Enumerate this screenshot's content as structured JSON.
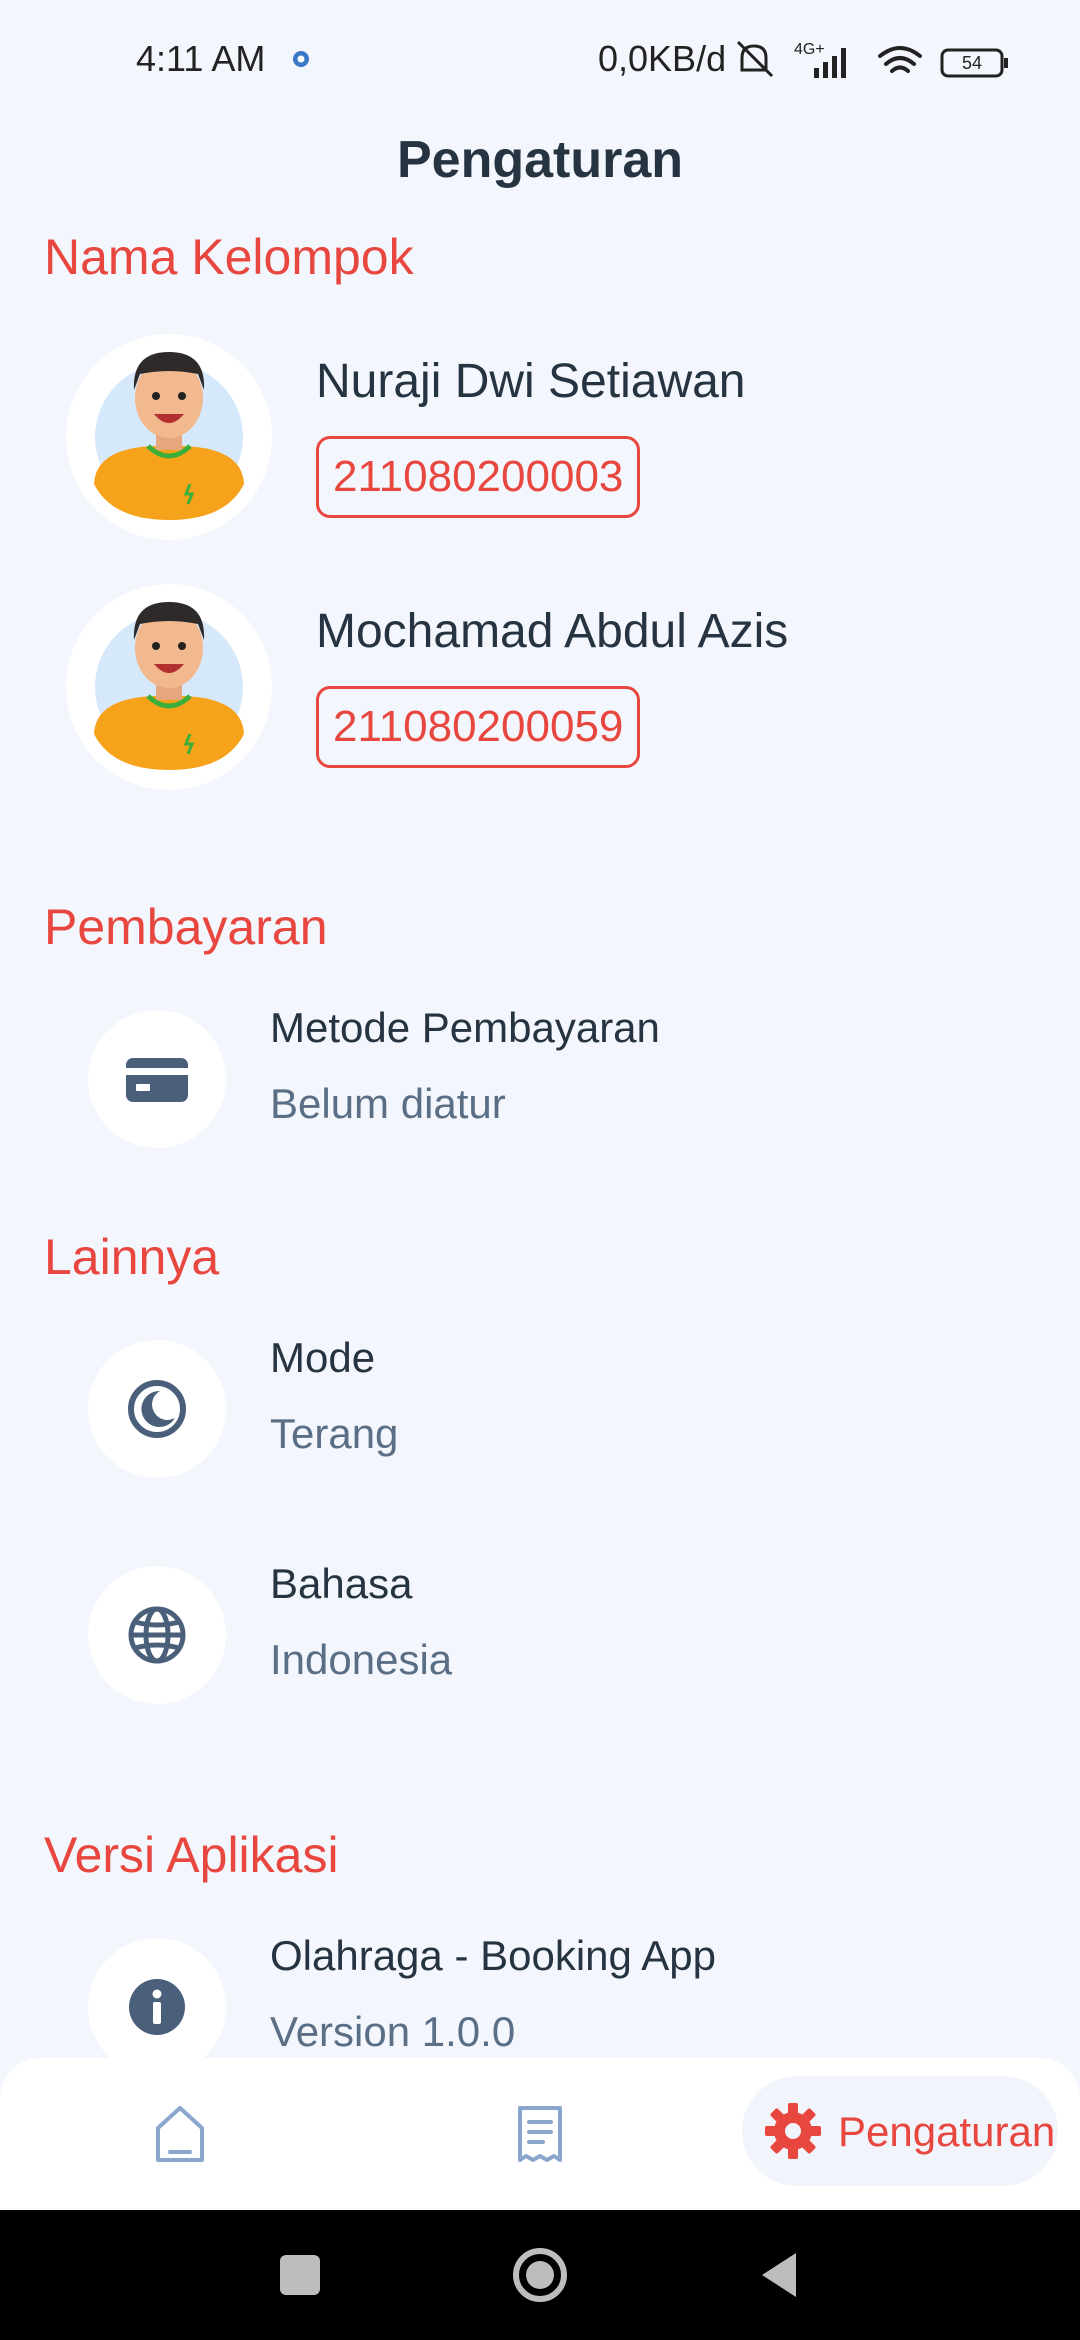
{
  "status_bar": {
    "time": "4:11 AM",
    "network_speed": "0,0KB/d",
    "network_type": "4G+",
    "battery": "54"
  },
  "header": {
    "title": "Pengaturan"
  },
  "sections": {
    "group": {
      "title": "Nama Kelompok"
    },
    "payment": {
      "title": "Pembayaran"
    },
    "others": {
      "title": "Lainnya"
    },
    "version": {
      "title": "Versi Aplikasi"
    }
  },
  "members": [
    {
      "name": "Nuraji Dwi Setiawan",
      "id": "211080200003"
    },
    {
      "name": "Mochamad Abdul Azis",
      "id": "211080200059"
    }
  ],
  "settings": {
    "payment_method": {
      "title": "Metode Pembayaran",
      "value": "Belum diatur",
      "icon": "credit-card-icon"
    },
    "mode": {
      "title": "Mode",
      "value": "Terang",
      "icon": "moon-icon"
    },
    "language": {
      "title": "Bahasa",
      "value": "Indonesia",
      "icon": "globe-icon"
    },
    "app_info": {
      "title": "Olahraga - Booking App",
      "value": "Version 1.0.0",
      "icon": "info-icon"
    }
  },
  "bottom_nav": {
    "items": [
      {
        "icon": "home-icon",
        "label": ""
      },
      {
        "icon": "receipt-icon",
        "label": ""
      },
      {
        "icon": "gear-icon",
        "label": "Pengaturan",
        "active": true
      }
    ]
  },
  "colors": {
    "accent": "#e8473f",
    "background": "#f3f6fc",
    "icon": "#4a5f7a",
    "text": "#263340",
    "subtext": "#5a6e85"
  }
}
